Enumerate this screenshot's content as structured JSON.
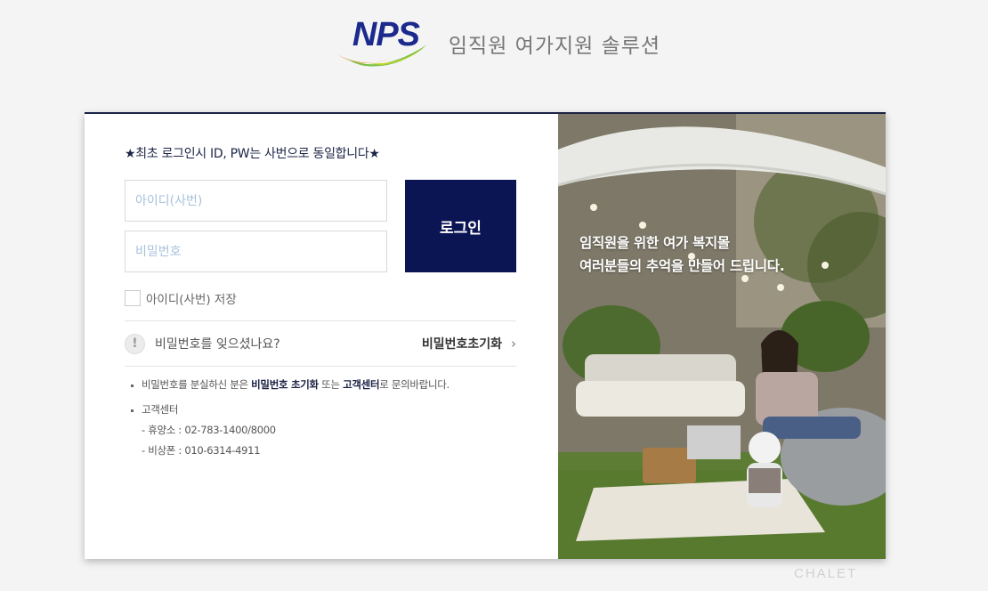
{
  "header": {
    "logo_text": "NPS",
    "title": "임직원 여가지원 솔루션"
  },
  "login": {
    "notice": "★최초 로그인시 ID, PW는 사번으로 동일합니다★",
    "id_placeholder": "아이디(사번)",
    "pw_placeholder": "비밀번호",
    "login_button": "로그인",
    "save_id_label": "아이디(사번) 저장",
    "forgot_text": "비밀번호를 잊으셨나요?",
    "reset_link": "비밀번호초기화",
    "warn_glyph": "!",
    "chevron_glyph": "›"
  },
  "info": {
    "line1_pre": "비밀번호를 분실하신 분은 ",
    "line1_b1": "비밀번호 초기화",
    "line1_mid": " 또는 ",
    "line1_b2": "고객센터",
    "line1_post": "로 문의바랍니다.",
    "cs_label": "고객센터",
    "phone1": "- 휴양소 : 02-783-1400/8000",
    "phone2": "- 비상폰 : 010-6314-4911"
  },
  "photo": {
    "line1": "임직원을 위한 여가 복지몰",
    "line2": "여러분들의 추억을 만들어 드립니다."
  },
  "watermark": "CHALET",
  "colors": {
    "navy": "#0c1554",
    "logo_blue": "#1b2a8c",
    "swoosh_orange": "#f08a1c",
    "swoosh_green": "#7bc043"
  }
}
